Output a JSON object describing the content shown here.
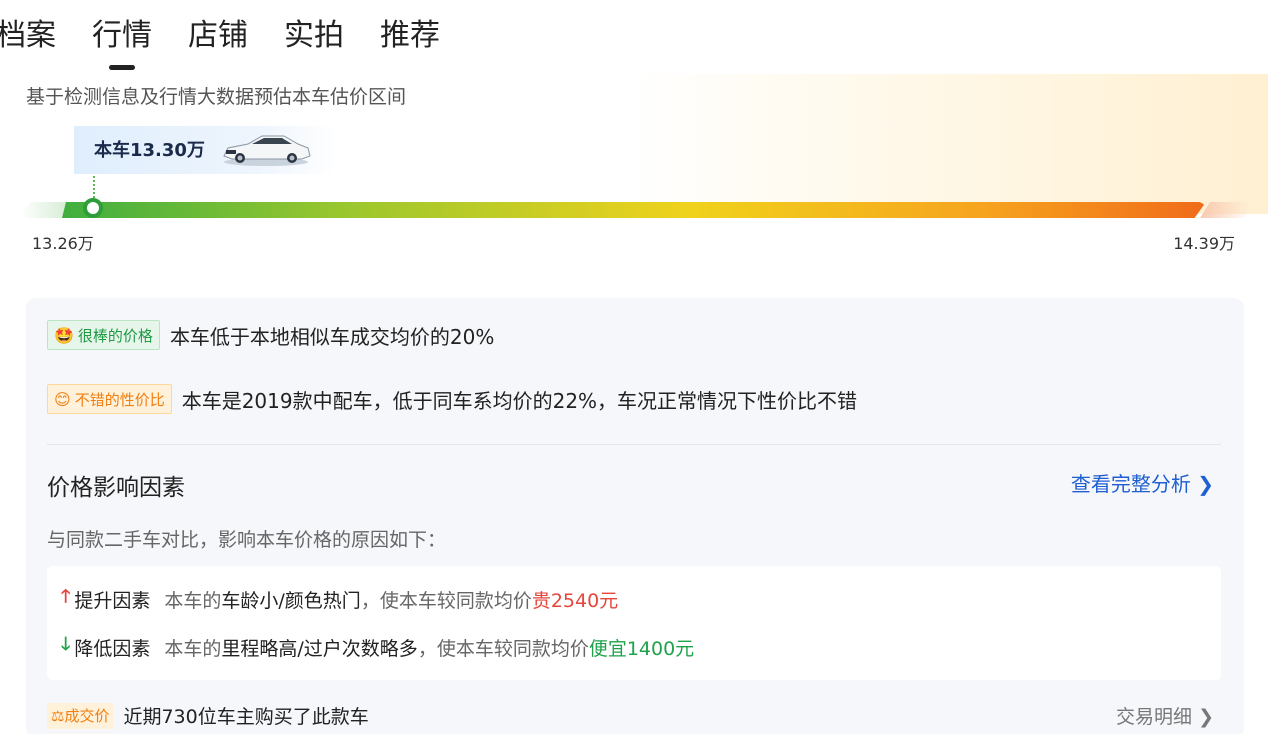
{
  "tabs": [
    "档案",
    "行情",
    "店铺",
    "实拍",
    "推荐"
  ],
  "active_tab": "行情",
  "hero": {
    "subtitle": "基于检测信息及行情大数据预估本车估价区间",
    "car_price_label": "本车13.30万",
    "range_min": "13.26万",
    "range_max": "14.39万"
  },
  "price_range": {
    "min": 13.26,
    "max": 14.39,
    "current": 13.3,
    "unit": "万"
  },
  "badges": [
    {
      "icon": "grinning-face-icon",
      "tag": "很棒的价格",
      "text": "本车低于本地相似车成交均价的20%"
    },
    {
      "icon": "smiling-face-icon",
      "tag": "不错的性价比",
      "text": "本车是2019款中配车，低于同车系均价的22%，车况正常情况下性价比不错"
    }
  ],
  "factors_section": {
    "title": "价格影响因素",
    "link": "查看完整分析",
    "description": "与同款二手车对比，影响本车价格的原因如下：",
    "up": {
      "label": "提升因素",
      "prefix": "本车的",
      "items": "车龄小/颜色热门",
      "middle": "，使本车较同款均价",
      "amount": "贵2540元"
    },
    "down": {
      "label": "降低因素",
      "prefix": "本车的",
      "items": "里程略高/过户次数略多",
      "middle": "，使本车较同款均价",
      "amount": "便宜1400元"
    }
  },
  "deal": {
    "tag": "成交价",
    "text": "近期730位车主购买了此款车",
    "link": "交易明细"
  },
  "colors": {
    "accent_blue": "#1f5fd1",
    "up_red": "#e4463b",
    "down_green": "#1fa24a",
    "tag_orange": "#f07f12"
  }
}
